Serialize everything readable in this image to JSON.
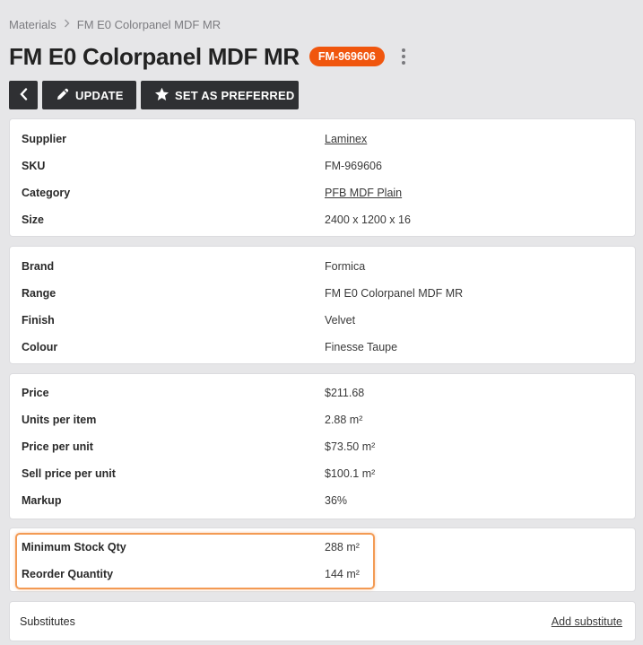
{
  "breadcrumb": {
    "parent": "Materials",
    "current": "FM E0 Colorpanel MDF MR"
  },
  "header": {
    "title": "FM E0 Colorpanel MDF MR",
    "sku_badge": "FM-969606",
    "badge_color": "#f0560e"
  },
  "toolbar": {
    "update_label": "UPDATE",
    "preferred_label": "SET AS PREFERRED"
  },
  "details": {
    "supplier_label": "Supplier",
    "supplier_value": "Laminex",
    "sku_label": "SKU",
    "sku_value": "FM-969606",
    "category_label": "Category",
    "category_value": "PFB MDF Plain",
    "size_label": "Size",
    "size_value": "2400 x 1200 x 16"
  },
  "product": {
    "brand_label": "Brand",
    "brand_value": "Formica",
    "range_label": "Range",
    "range_value": "FM E0 Colorpanel MDF MR",
    "finish_label": "Finish",
    "finish_value": "Velvet",
    "colour_label": "Colour",
    "colour_value": "Finesse Taupe"
  },
  "pricing": {
    "price_label": "Price",
    "price_value": "$211.68",
    "units_label": "Units per item",
    "units_value": "2.88 m²",
    "ppu_label": "Price per unit",
    "ppu_value": "$73.50 m²",
    "sppu_label": "Sell price per unit",
    "sppu_value": "$100.1 m²",
    "markup_label": "Markup",
    "markup_value": "36%"
  },
  "stock": {
    "min_label": "Minimum Stock Qty",
    "min_value": "288 m²",
    "reorder_label": "Reorder Quantity",
    "reorder_value": "144 m²",
    "highlight_color": "#f39a53"
  },
  "substitutes": {
    "label": "Substitutes",
    "add_label": "Add substitute"
  }
}
